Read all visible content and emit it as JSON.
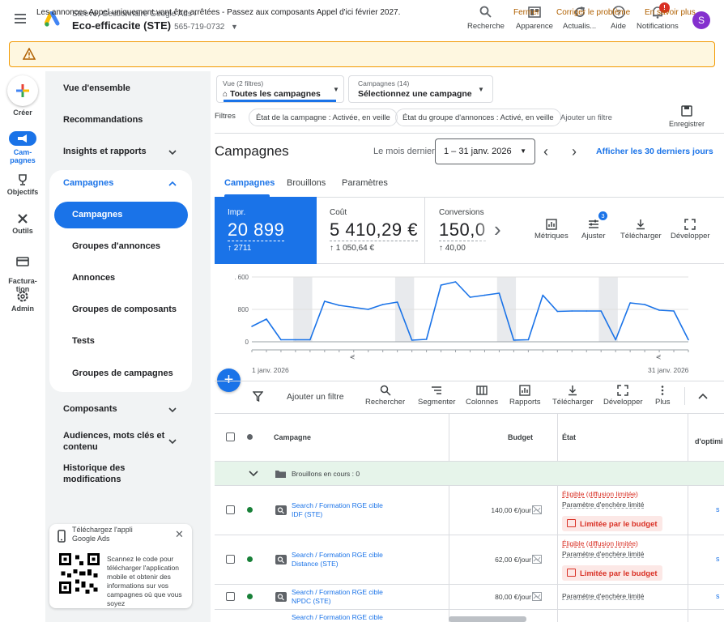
{
  "topbar": {
    "account_sub": "Steeve, Gestionnaire Google Ads",
    "account_name": "Eco-efficacite (STE)",
    "account_id": "565-719-0732",
    "buttons": [
      {
        "label": "Recherche",
        "icon": "search-icon"
      },
      {
        "label": "Apparence",
        "icon": "appearance-icon"
      },
      {
        "label": "Actualis...",
        "icon": "refresh-icon"
      },
      {
        "label": "Aide",
        "icon": "help-icon"
      },
      {
        "label": "Notifications",
        "icon": "bell-icon"
      }
    ],
    "notif_badge": "!",
    "avatar_letter": "S"
  },
  "alert": {
    "text": "Les annonces Appel uniquement vont être arrêtées - Passez aux composants Appel d'ici février 2027.",
    "actions": [
      "Fermer",
      "Corriger le problème",
      "En savoir plus"
    ]
  },
  "rail": {
    "create": "Créer",
    "items": [
      "Cam-\npagnes",
      "Objectifs",
      "Outils",
      "Factura-\ntion",
      "Admin"
    ]
  },
  "nav": {
    "items_top": [
      "Vue d'ensemble",
      "Recommandations",
      "Insights et rapports"
    ],
    "campaigns_header": "Campagnes",
    "campaign_sub": [
      "Campagnes",
      "Groupes d'annonces",
      "Annonces",
      "Groupes de composants",
      "Tests",
      "Groupes de campagnes"
    ],
    "items_bottom": [
      "Composants",
      "Audiences, mots clés et\ncontenu",
      "Historique des\nmodifications"
    ]
  },
  "download_card": {
    "title": "Téléchargez l'appli\nGoogle Ads",
    "text": "Scannez le code pour télécharger l'application mobile et obtenir des informations sur vos campagnes où que vous soyez"
  },
  "filters": {
    "view_small": "Vue (2 filtres)",
    "view_main": "Toutes les campagnes",
    "campaigns_small": "Campagnes (14)",
    "campaigns_main": "Sélectionnez une campagne",
    "label": "Filtres",
    "chips": [
      "État de la campagne : Activée, en veille",
      "État du groupe d'annonces : Activé, en veille"
    ],
    "add_filter": "Ajouter un filtre",
    "save": "Enregistrer"
  },
  "header": {
    "title": "Campagnes",
    "period_label": "Le mois dernier",
    "date_range": "1 – 31 janv. 2026",
    "last30": "Afficher les 30 derniers jours"
  },
  "tabs": [
    "Campagnes",
    "Brouillons",
    "Paramètres"
  ],
  "metrics": [
    {
      "label": "Impr.",
      "value": "20 899",
      "delta": "2711"
    },
    {
      "label": "Coût",
      "value": "5 410,29 €",
      "delta": "1 050,64 €"
    },
    {
      "label": "Conversions",
      "value": "150,0",
      "delta": "40,00"
    }
  ],
  "metric_tools": [
    {
      "label": "Métriques",
      "icon": "metrics-icon"
    },
    {
      "label": "Ajuster",
      "icon": "adjust-icon",
      "badge": "3"
    },
    {
      "label": "Télécharger",
      "icon": "download-icon"
    },
    {
      "label": "Développer",
      "icon": "expand-icon"
    }
  ],
  "chart_data": {
    "type": "line",
    "x_labels": [
      "1 janv. 2026",
      "31 janv. 2026"
    ],
    "y_ticks": [
      "0",
      "800",
      "1 600"
    ],
    "ylim": [
      0,
      1600
    ],
    "color": "#1a73e8",
    "series": [
      {
        "values": [
          380,
          560,
          50,
          50,
          50,
          1000,
          900,
          850,
          800,
          920,
          980,
          40,
          60,
          1400,
          1480,
          1100,
          1150,
          1200,
          40,
          50,
          1150,
          750,
          760,
          760,
          760,
          50,
          960,
          920,
          780,
          760,
          50
        ]
      }
    ],
    "weekend_bands": [
      [
        3,
        4
      ],
      [
        10,
        11
      ],
      [
        17,
        18
      ],
      [
        24,
        25
      ]
    ]
  },
  "table_toolbar": {
    "add_filter": "Ajouter un filtre",
    "buttons": [
      "Rechercher",
      "Segmenter",
      "Colonnes",
      "Rapports",
      "Télécharger",
      "Développer",
      "Plus"
    ]
  },
  "table": {
    "headers": {
      "campaign": "Campagne",
      "budget": "Budget",
      "etat": "État",
      "extra": "d'optimi"
    },
    "drafts": "Brouillons en cours : 0",
    "rows": [
      {
        "name": "Search / Formation RGE cible\nIDF (STE)",
        "budget": "140,00 €/jour",
        "etat1": "Éligible (diffusion limitée)",
        "etat2": "Paramètre d'enchère limité",
        "limited": "Limitée par le budget"
      },
      {
        "name": "Search / Formation RGE cible\nDistance (STE)",
        "budget": "62,00 €/jour",
        "etat1": "Éligible (diffusion limitée)",
        "etat2": "Paramètre d'enchère limité",
        "limited": "Limitée par le budget"
      },
      {
        "name": "Search / Formation RGE cible\nNPDC (STE)",
        "budget": "80,00 €/jour",
        "etat1": "",
        "etat2": "Paramètre d'enchère limité",
        "limited": ""
      }
    ],
    "partial_row": "Search / Formation RGE cible"
  }
}
